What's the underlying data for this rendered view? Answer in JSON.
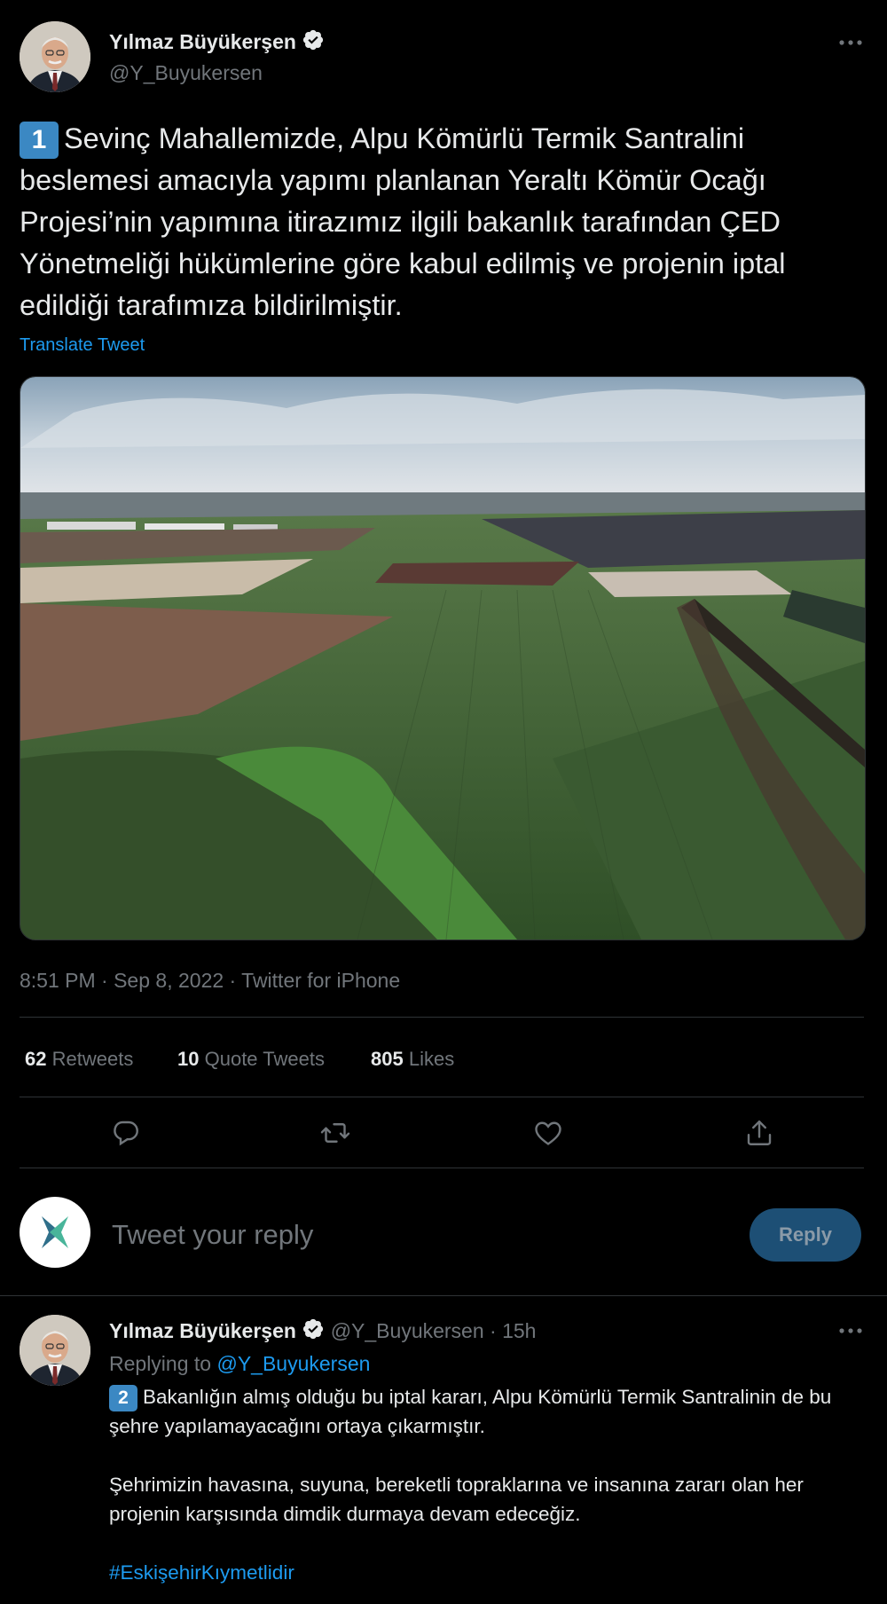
{
  "tweet": {
    "author_name": "Yılmaz Büyükerşen",
    "author_handle": "@Y_Buyukersen",
    "keycap": "1",
    "text": "Sevinç Mahallemizde, Alpu Kömürlü Termik Santralini beslemesi amacıyla yapımı planlanan Yeraltı Kömür Ocağı Projesi’nin yapımına itirazımız ilgili bakanlık tarafından ÇED Yönetmeliği hükümlerine göre kabul edilmiş ve projenin iptal edildiği tarafımıza bildirilmiştir.",
    "translate": "Translate Tweet",
    "timestamp": "8:51 PM · Sep 8, 2022 · Twitter for iPhone",
    "stats": {
      "retweets_count": "62",
      "retweets_label": "Retweets",
      "quotes_count": "10",
      "quotes_label": "Quote Tweets",
      "likes_count": "805",
      "likes_label": "Likes"
    }
  },
  "composer": {
    "placeholder": "Tweet your reply",
    "button": "Reply"
  },
  "reply": {
    "author_name": "Yılmaz Büyükerşen",
    "author_handle": "@Y_Buyukersen",
    "time": "· 15h",
    "replying_prefix": "Replying to",
    "replying_handle": "@Y_Buyukersen",
    "keycap": "2",
    "para1": "Bakanlığın almış olduğu bu iptal kararı, Alpu Kömürlü Termik Santralinin de bu şehre yapılamayacağını ortaya çıkarmıştır.",
    "para2": "Şehrimizin havasına, suyuna, bereketli topraklarına ve insanına zararı olan her projenin karşısında dimdik durmaya devam edeceğiz.",
    "hashtag": "#EskişehirKıymetlidir"
  },
  "icons": {
    "more": "more-icon",
    "verified": "verified-badge-icon",
    "reply": "reply-icon",
    "retweet": "retweet-icon",
    "like": "heart-icon",
    "share": "share-icon"
  },
  "colors": {
    "background": "#000000",
    "text": "#e7e9ea",
    "muted": "#71767b",
    "link": "#1d9bf0",
    "reply_button": "#1d4f75",
    "divider": "#2f3336"
  }
}
